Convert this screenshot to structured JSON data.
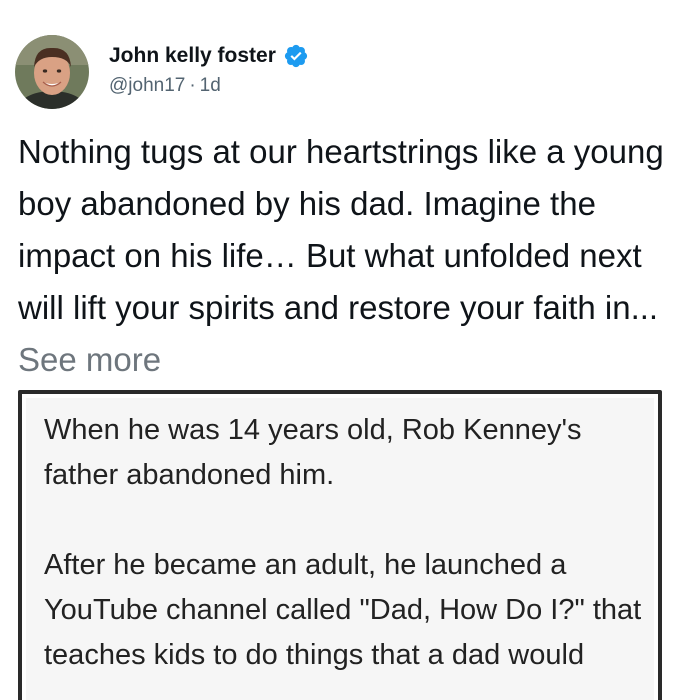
{
  "post": {
    "author_name": "John kelly foster",
    "handle": "@john17",
    "separator": "·",
    "time": "1d",
    "text": "Nothing tugs at our heartstrings like a young boy abandoned by his dad. Imagine the impact on his life… But what unfolded next will lift your spirits and restore your faith in...",
    "see_more": "See more"
  },
  "media": {
    "paragraphs": [
      "When he was 14 years old, Rob Kenney's father abandoned him.",
      "After he became an adult, he launched a YouTube channel called \"Dad, How Do I?\" that teaches kids to do things that a dad would"
    ]
  },
  "colors": {
    "verified_badge": "#1d9bf0",
    "name": "#0f1419",
    "secondary_text": "#536471",
    "see_more": "#6e767d",
    "card_border": "#2a2a2a"
  },
  "icons": {
    "avatar": "avatar-photo",
    "verified": "verified-badge-icon"
  }
}
